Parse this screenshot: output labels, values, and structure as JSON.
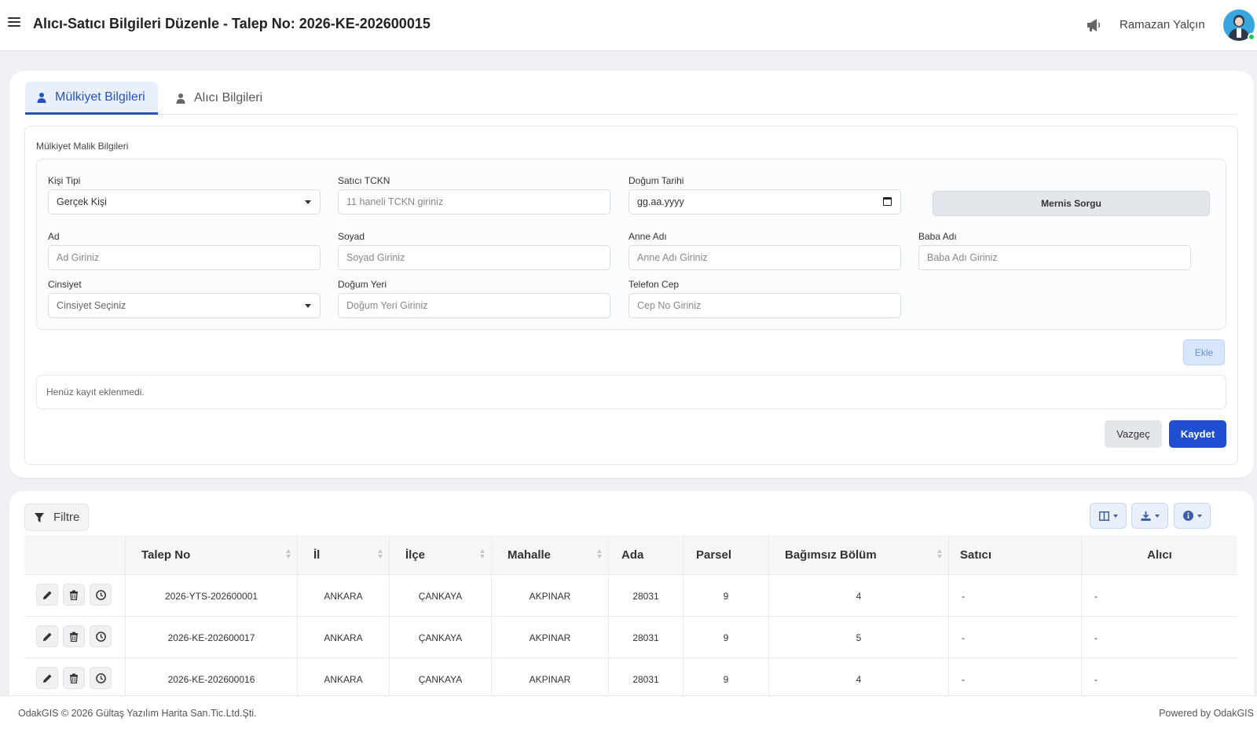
{
  "header": {
    "title": "Alıcı-Satıcı Bilgileri Düzenle - Talep No: 2026-KE-202600015",
    "user_name": "Ramazan Yalçın",
    "icons": {
      "menu": "hamburger-icon",
      "announce": "megaphone-icon",
      "avatar": "user-avatar"
    }
  },
  "tabs": [
    {
      "label": "Mülkiyet Bilgileri",
      "active": true,
      "icon": "user-icon"
    },
    {
      "label": "Alıcı Bilgileri",
      "active": false,
      "icon": "user-icon"
    }
  ],
  "form": {
    "section_title": "Mülkiyet Malik Bilgileri",
    "kisi_tipi": {
      "label": "Kişi Tipi",
      "value": "Gerçek Kişi"
    },
    "satici_tckn": {
      "label": "Satıcı TCKN",
      "placeholder": "11 haneli TCKN giriniz"
    },
    "dogum_tarihi": {
      "label": "Doğum Tarihi",
      "value": "gg.aa.yyyy"
    },
    "mernis_button": "Mernis Sorgu",
    "ad": {
      "label": "Ad",
      "placeholder": "Ad Giriniz"
    },
    "soyad": {
      "label": "Soyad",
      "placeholder": "Soyad Giriniz"
    },
    "anne_adi": {
      "label": "Anne Adı",
      "placeholder": "Anne Adı Giriniz"
    },
    "baba_adi": {
      "label": "Baba Adı",
      "placeholder": "Baba Adı Giriniz"
    },
    "cinsiyet": {
      "label": "Cinsiyet",
      "value": "Cinsiyet Seçiniz"
    },
    "dogum_yeri": {
      "label": "Doğum Yeri",
      "placeholder": "Doğum Yeri Giriniz"
    },
    "telefon": {
      "label": "Telefon Cep",
      "placeholder": "Cep No Giriniz"
    },
    "ekle_button": "Ekle",
    "empty_message": "Henüz kayıt eklenmedi.",
    "cancel_button": "Vazgeç",
    "save_button": "Kaydet"
  },
  "table": {
    "filter_label": "Filtre",
    "columns": [
      "Talep No",
      "İl",
      "İlçe",
      "Mahalle",
      "Ada",
      "Parsel",
      "Bağımsız Bölüm",
      "Satıcı",
      "Alıcı"
    ],
    "rows": [
      {
        "talep_no": "2026-YTS-202600001",
        "il": "ANKARA",
        "ilce": "ÇANKAYA",
        "mahalle": "AKPINAR",
        "ada": "28031",
        "parsel": "9",
        "bagimsiz_bolum": "4",
        "satici": "-",
        "alici": "-"
      },
      {
        "talep_no": "2026-KE-202600017",
        "il": "ANKARA",
        "ilce": "ÇANKAYA",
        "mahalle": "AKPINAR",
        "ada": "28031",
        "parsel": "9",
        "bagimsiz_bolum": "5",
        "satici": "-",
        "alici": "-"
      },
      {
        "talep_no": "2026-KE-202600016",
        "il": "ANKARA",
        "ilce": "ÇANKAYA",
        "mahalle": "AKPINAR",
        "ada": "28031",
        "parsel": "9",
        "bagimsiz_bolum": "4",
        "satici": "-",
        "alici": "-"
      }
    ]
  },
  "footer": {
    "left": "OdakGIS © 2026 Gültaş Yazılım Harita San.Tic.Ltd.Şti.",
    "right": "Powered by OdakGIS"
  },
  "colors": {
    "primary": "#1f4fd0",
    "tab_active": "#2453c7",
    "status_online": "#22c55e"
  }
}
